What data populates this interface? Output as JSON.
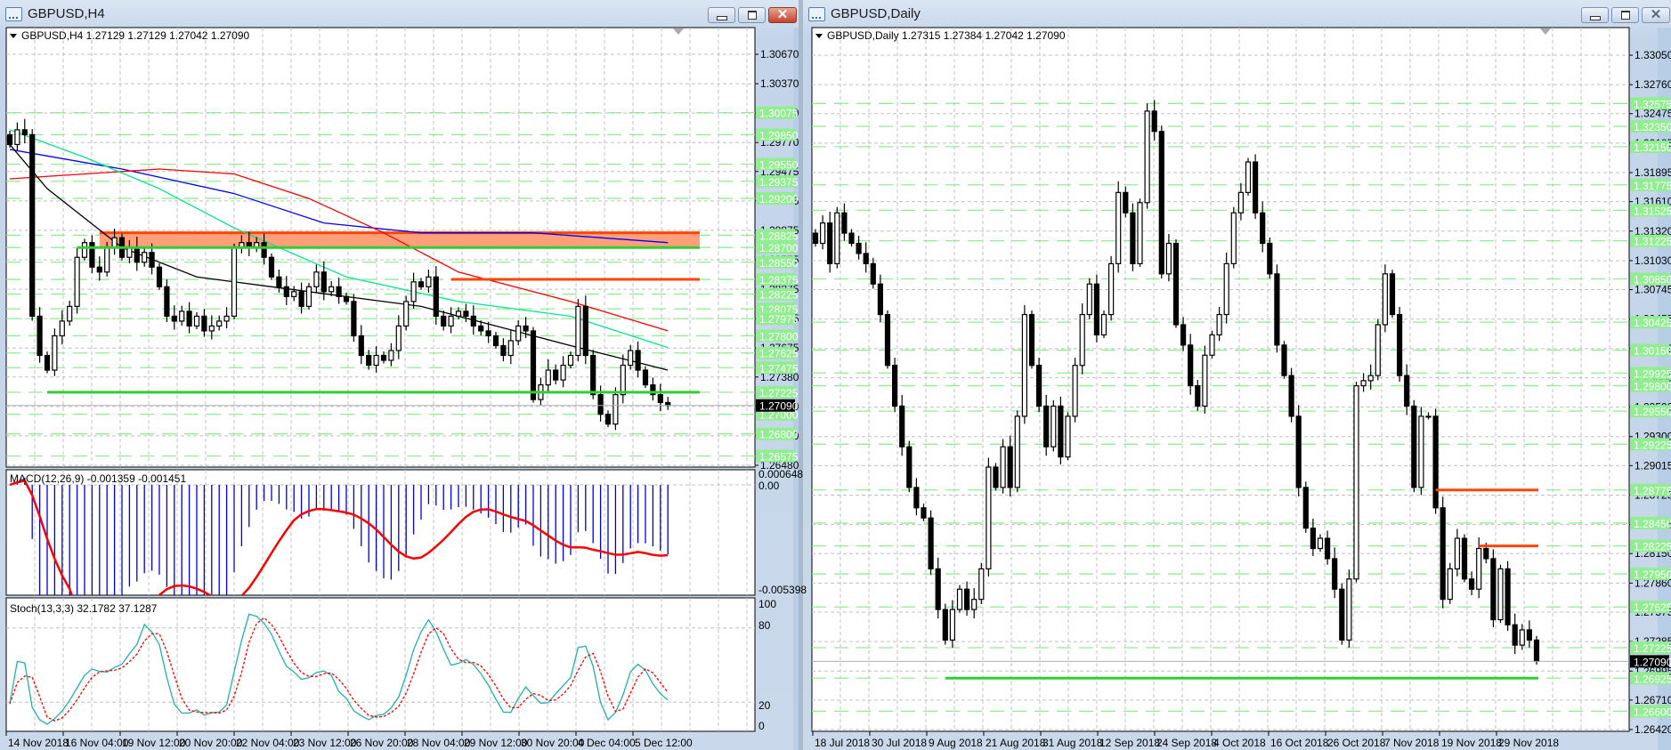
{
  "windows": {
    "left": {
      "title": "GBPUSD,H4",
      "header": "GBPUSD,H4  1.27129 1.27129 1.27042 1.27090"
    },
    "right": {
      "title": "GBPUSD,Daily",
      "header": "GBPUSD,Daily  1.27315 1.27384 1.27042 1.27090"
    },
    "close_glyph": "✕"
  },
  "colors": {
    "bull": "#ffffff",
    "bear": "#000000",
    "level": "#90ee90",
    "zone": "#ffa07a",
    "orange": "#ff4500",
    "support": "#32cd32",
    "grid": "#c0c0c0"
  },
  "left_chart": {
    "current_price": 1.2709,
    "current_price_label": "1.27090",
    "grid_levels": [
      "1.30670",
      "1.30370",
      "1.30070",
      "1.29770",
      "1.29475",
      "1.29175",
      "1.28875",
      "1.28575",
      "1.28275",
      "1.27975",
      "1.27675",
      "1.27380",
      "1.27080",
      "1.26780",
      "1.26480"
    ],
    "levels": [
      "1.30075",
      "1.29850",
      "1.29550",
      "1.29375",
      "1.29200",
      "1.28825",
      "1.28700",
      "1.28550",
      "1.28375",
      "1.28225",
      "1.28075",
      "1.27975",
      "1.27800",
      "1.27625",
      "1.27475",
      "1.27225",
      "1.27000",
      "1.26800",
      "1.26575"
    ],
    "zone": {
      "top": 1.2885,
      "bottom": 1.287,
      "from_index": 12
    },
    "orange_lines": [
      {
        "price": 1.28375,
        "from_index": 59
      }
    ],
    "support_lines": [
      {
        "price": 1.287,
        "from_index": 9
      },
      {
        "price": 1.27225,
        "from_index": 5
      }
    ],
    "closes": [
      1.2975,
      1.299,
      1.2985,
      1.28,
      1.276,
      1.2745,
      1.278,
      1.2795,
      1.281,
      1.286,
      1.2875,
      1.285,
      1.2845,
      1.287,
      1.288,
      1.286,
      1.287,
      1.2855,
      1.2865,
      1.285,
      1.283,
      1.28,
      1.2795,
      1.2805,
      1.279,
      1.28,
      1.2785,
      1.279,
      1.2795,
      1.28,
      1.287,
      1.2875,
      1.287,
      1.2875,
      1.286,
      1.284,
      1.283,
      1.282,
      1.2825,
      1.281,
      1.283,
      1.2845,
      1.2825,
      1.283,
      1.282,
      1.2815,
      1.278,
      1.276,
      1.275,
      1.276,
      1.2755,
      1.2765,
      1.279,
      1.2815,
      1.2835,
      1.283,
      1.284,
      1.28,
      1.279,
      1.28,
      1.2805,
      1.28,
      1.279,
      1.2785,
      1.278,
      1.277,
      1.276,
      1.2775,
      1.279,
      1.2785,
      1.2715,
      1.273,
      1.2745,
      1.2735,
      1.275,
      1.276,
      1.281,
      1.276,
      1.272,
      1.27,
      1.269,
      1.272,
      1.275,
      1.2765,
      1.2745,
      1.273,
      1.272,
      1.2712,
      1.2709
    ],
    "moving_averages": [
      {
        "name": "blue-ma",
        "color": "#0000ff",
        "points": [
          [
            0,
            1.297
          ],
          [
            15,
            1.295
          ],
          [
            30,
            1.2925
          ],
          [
            42,
            1.2895
          ],
          [
            55,
            1.2885
          ],
          [
            70,
            1.2885
          ],
          [
            88,
            1.2875
          ]
        ]
      },
      {
        "name": "red-ma",
        "color": "#ff0000",
        "points": [
          [
            0,
            1.294
          ],
          [
            10,
            1.2945
          ],
          [
            20,
            1.295
          ],
          [
            30,
            1.2945
          ],
          [
            40,
            1.292
          ],
          [
            50,
            1.2885
          ],
          [
            60,
            1.2845
          ],
          [
            75,
            1.2815
          ],
          [
            88,
            1.2785
          ]
        ]
      },
      {
        "name": "green-ma",
        "color": "#00e68a",
        "points": [
          [
            0,
            1.299
          ],
          [
            10,
            1.2962
          ],
          [
            20,
            1.293
          ],
          [
            30,
            1.289
          ],
          [
            45,
            1.284
          ],
          [
            60,
            1.2815
          ],
          [
            75,
            1.28
          ],
          [
            88,
            1.2768
          ]
        ]
      },
      {
        "name": "black-ma",
        "color": "#000000",
        "points": [
          [
            0,
            1.2975
          ],
          [
            5,
            1.293
          ],
          [
            15,
            1.287
          ],
          [
            25,
            1.284
          ],
          [
            35,
            1.283
          ],
          [
            45,
            1.282
          ],
          [
            55,
            1.281
          ],
          [
            65,
            1.279
          ],
          [
            75,
            1.277
          ],
          [
            88,
            1.2745
          ]
        ]
      }
    ],
    "dates": [
      "14 Nov 2018",
      "16 Nov 04:00",
      "19 Nov 12:00",
      "20 Nov 20:00",
      "22 Nov 04:00",
      "23 Nov 12:00",
      "26 Nov 20:00",
      "28 Nov 04:00",
      "29 Nov 12:00",
      "30 Nov 20:00",
      "4 Dec 04:00",
      "5 Dec 12:00"
    ],
    "macd": {
      "label": "MACD(12,26,9) -0.001359 -0.001451",
      "axis": [
        "0.000648",
        "0.00",
        "-0.005398"
      ],
      "max": 0.000648,
      "min": -0.005398
    },
    "stoch": {
      "label": "Stoch(13,3,3) 32.1782 37.1287",
      "axis": [
        "100",
        "80",
        "20",
        "0"
      ]
    }
  },
  "right_chart": {
    "current_price": 1.2709,
    "current_price_label": "1.27090",
    "grid_levels": [
      "1.33050",
      "1.32760",
      "1.32475",
      "1.32185",
      "1.31895",
      "1.31610",
      "1.31320",
      "1.31030",
      "1.30745",
      "1.30455",
      "1.30165",
      "1.29880",
      "1.29590",
      "1.29300",
      "1.29015",
      "1.28725",
      "1.28435",
      "1.28150",
      "1.27860",
      "1.27575",
      "1.27285",
      "1.26995",
      "1.26710",
      "1.26420"
    ],
    "levels": [
      "1.32575",
      "1.32350",
      "1.32150",
      "1.31775",
      "1.31525",
      "1.31225",
      "1.30850",
      "1.30425",
      "1.30150",
      "1.29925",
      "1.29800",
      "1.29550",
      "1.29225",
      "1.28775",
      "1.28450",
      "1.28225",
      "1.27950",
      "1.27625",
      "1.27225",
      "1.26925",
      "1.26600"
    ],
    "orange_lines": [
      {
        "price": 1.28775,
        "from_index": 86
      },
      {
        "price": 1.28225,
        "from_index": 92
      }
    ],
    "support_lines": [
      {
        "price": 1.26925,
        "from_index": 18
      }
    ],
    "closes": [
      1.312,
      1.314,
      1.31,
      1.315,
      1.313,
      1.312,
      1.311,
      1.31,
      1.308,
      1.305,
      1.3,
      1.296,
      1.292,
      1.288,
      1.286,
      1.285,
      1.28,
      1.276,
      1.273,
      1.276,
      1.278,
      1.276,
      1.277,
      1.28,
      1.29,
      1.288,
      1.292,
      1.288,
      1.295,
      1.305,
      1.3,
      1.296,
      1.292,
      1.296,
      1.291,
      1.295,
      1.3,
      1.305,
      1.308,
      1.303,
      1.305,
      1.31,
      1.317,
      1.315,
      1.31,
      1.316,
      1.325,
      1.323,
      1.309,
      1.312,
      1.304,
      1.302,
      1.298,
      1.296,
      1.301,
      1.303,
      1.305,
      1.31,
      1.315,
      1.317,
      1.32,
      1.315,
      1.312,
      1.309,
      1.302,
      1.299,
      1.295,
      1.288,
      1.284,
      1.282,
      1.283,
      1.281,
      1.278,
      1.273,
      1.279,
      1.298,
      1.2985,
      1.299,
      1.304,
      1.309,
      1.305,
      1.299,
      1.296,
      1.288,
      1.295,
      1.295,
      1.286,
      1.277,
      1.28,
      1.283,
      1.279,
      1.278,
      1.282,
      1.281,
      1.275,
      1.28,
      1.2745,
      1.2725,
      1.274,
      1.273,
      1.2709
    ],
    "dates": [
      "18 Jul 2018",
      "30 Jul 2018",
      "9 Aug 2018",
      "21 Aug 2018",
      "31 Aug 2018",
      "12 Sep 2018",
      "24 Sep 2018",
      "4 Oct 2018",
      "16 Oct 2018",
      "26 Oct 2018",
      "7 Nov 2018",
      "19 Nov 2018",
      "29 Nov 2018"
    ]
  }
}
